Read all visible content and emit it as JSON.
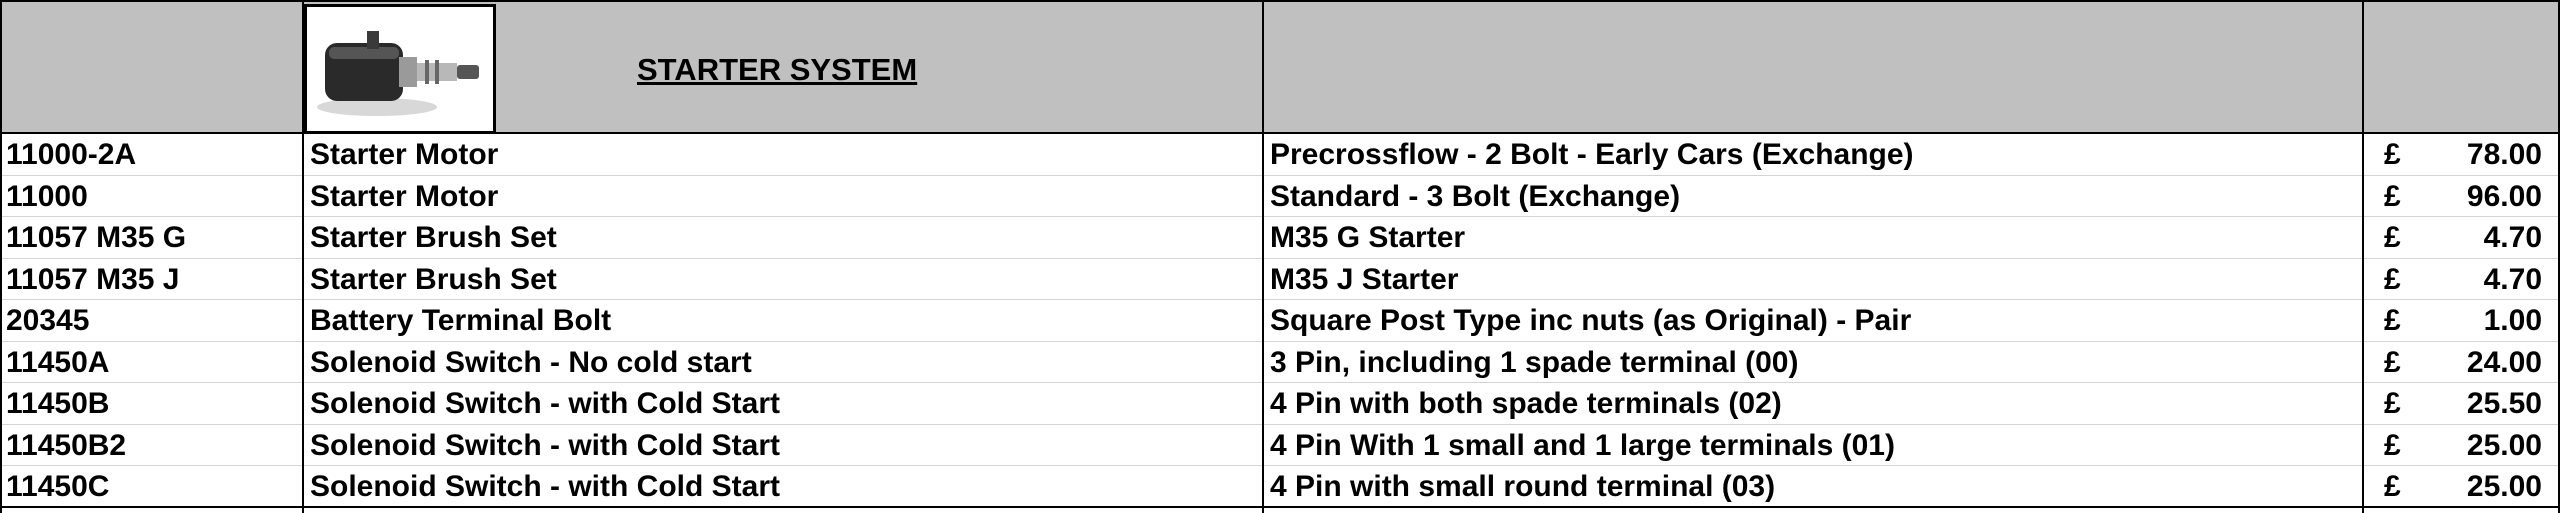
{
  "header": {
    "title": "STARTER SYSTEM",
    "image_icon": "starter-motor-photo"
  },
  "rows": [
    {
      "part": "11000-2A",
      "description": "Starter Motor",
      "notes": "Precrossflow - 2 Bolt - Early Cars (Exchange)",
      "currency": "£",
      "price": "78.00"
    },
    {
      "part": "11000",
      "description": "Starter Motor",
      "notes": "Standard - 3 Bolt (Exchange)",
      "currency": "£",
      "price": "96.00"
    },
    {
      "part": "11057 M35 G",
      "description": "Starter Brush Set",
      "notes": "M35 G Starter",
      "currency": "£",
      "price": "4.70"
    },
    {
      "part": "11057 M35 J",
      "description": "Starter Brush Set",
      "notes": "M35 J Starter",
      "currency": "£",
      "price": "4.70"
    },
    {
      "part": "20345",
      "description": "Battery Terminal Bolt",
      "notes": "Square Post Type inc nuts (as Original) - Pair",
      "currency": "£",
      "price": "1.00"
    },
    {
      "part": "11450A",
      "description": "Solenoid Switch - No cold start",
      "notes": "3 Pin, including 1 spade terminal (00)",
      "currency": "£",
      "price": "24.00"
    },
    {
      "part": "11450B",
      "description": "Solenoid Switch - with Cold Start",
      "notes": "4 Pin with both spade terminals (02)",
      "currency": "£",
      "price": "25.50"
    },
    {
      "part": "11450B2",
      "description": "Solenoid Switch - with Cold Start",
      "notes": "4 Pin With 1 small and 1 large terminals (01)",
      "currency": "£",
      "price": "25.00"
    },
    {
      "part": "11450C",
      "description": "Solenoid Switch - with Cold Start",
      "notes": "4 Pin with small round terminal (03)",
      "currency": "£",
      "price": "25.00"
    }
  ]
}
